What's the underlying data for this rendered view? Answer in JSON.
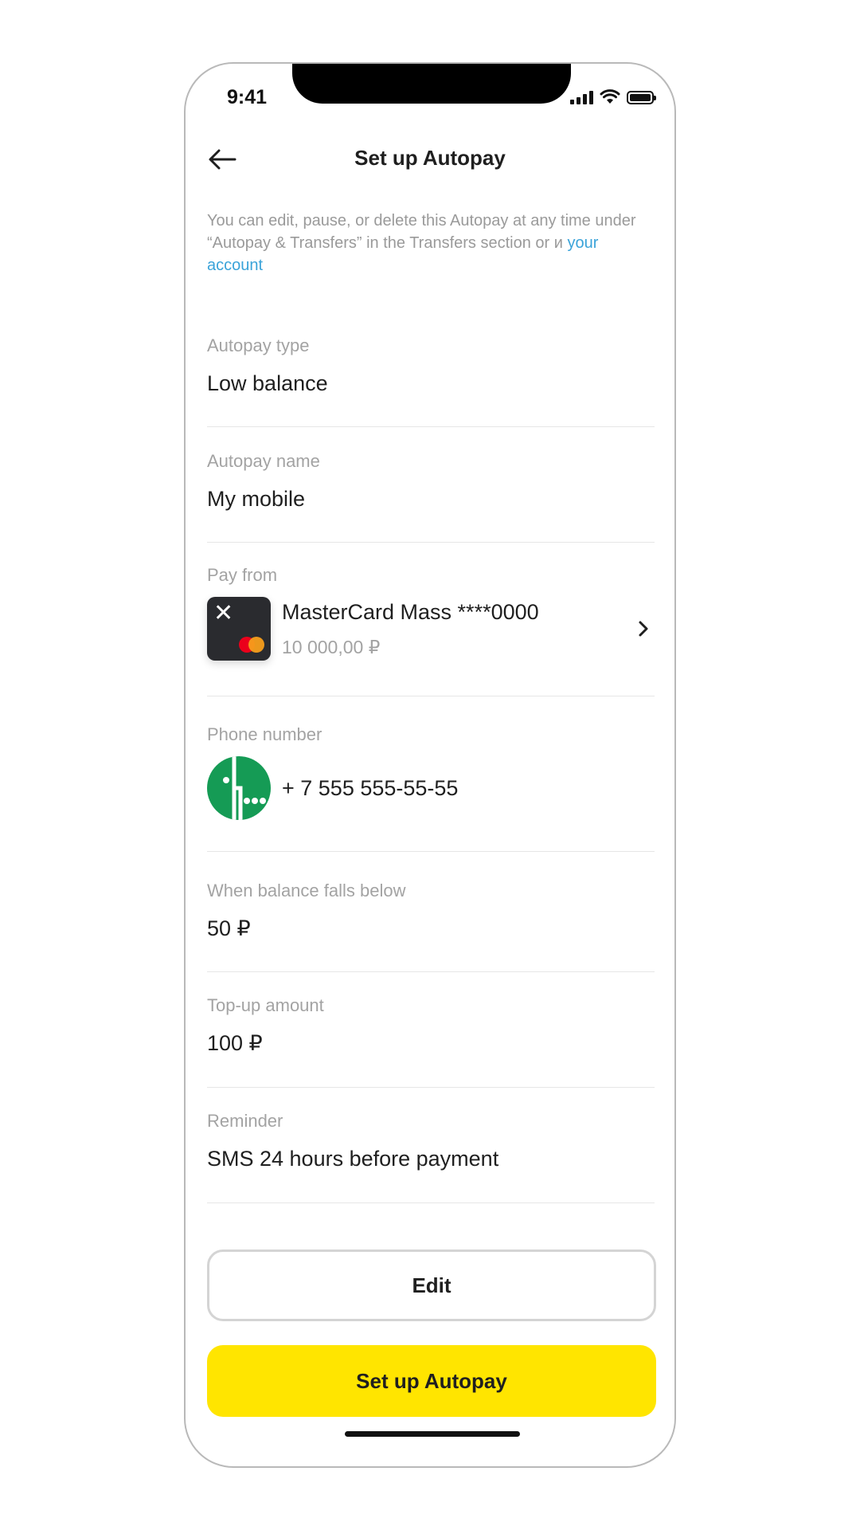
{
  "status_bar": {
    "time": "9:41"
  },
  "header": {
    "title": "Set up Autopay"
  },
  "note": {
    "text": "You can edit, pause, or delete this Autopay at any time under “Autopay & Transfers” in the Transfers section or и ",
    "link": "your account"
  },
  "fields": {
    "autopay_type": {
      "label": "Autopay type",
      "value": "Low balance"
    },
    "autopay_name": {
      "label": "Autopay name",
      "value": "My mobile"
    },
    "pay_from": {
      "label": "Pay from",
      "card_name": "MasterCard Mass ****0000",
      "balance": "10 000,00 ₽",
      "card_logo": "✕"
    },
    "phone_number": {
      "label": "Phone number",
      "value": "+ 7 555 555-55-55"
    },
    "threshold": {
      "label": "When balance falls below",
      "value": "50 ₽"
    },
    "topup": {
      "label": "Top-up amount",
      "value": "100 ₽"
    },
    "reminder": {
      "label": "Reminder",
      "value": "SMS 24 hours before payment"
    }
  },
  "buttons": {
    "edit": "Edit",
    "setup": "Set up Autopay"
  },
  "icons": {
    "back": "arrow-left-icon",
    "chevron": "chevron-right-icon",
    "card": "card-icon",
    "operator": "operator-logo-icon"
  },
  "colors": {
    "accent_yellow": "#ffe500",
    "link_blue": "#3aa3d9",
    "operator_green": "#159b55",
    "card_dark": "#2a2b2f"
  }
}
